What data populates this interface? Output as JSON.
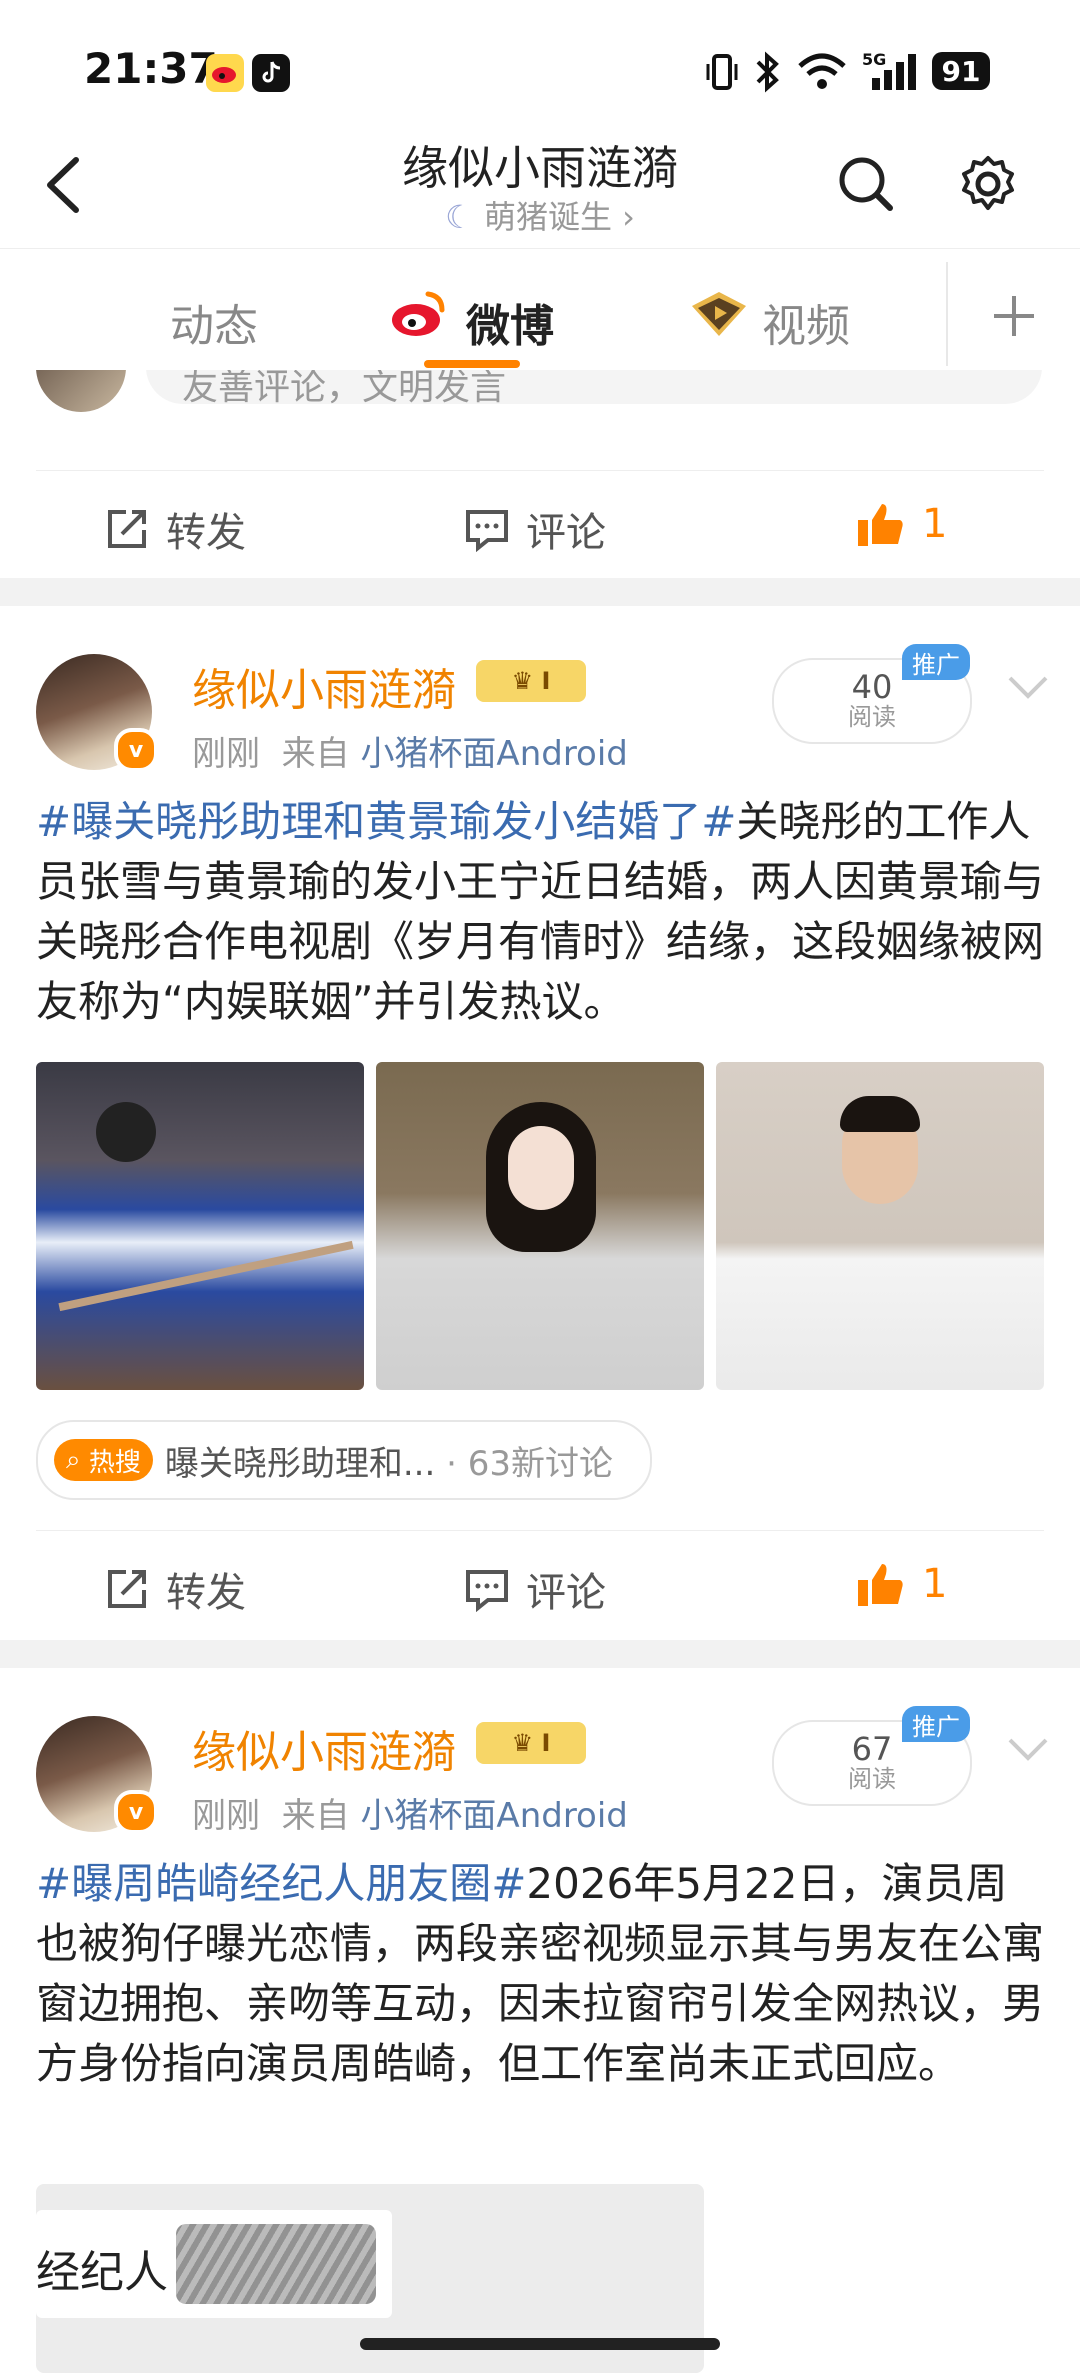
{
  "status_bar": {
    "time": "21:37",
    "battery": "91",
    "network": "5G"
  },
  "header": {
    "title": "缘似小雨涟漪",
    "subtitle": "萌猪诞生",
    "subtitle_chevron": "›"
  },
  "tabs": [
    {
      "label": "动态"
    },
    {
      "label": "微博"
    },
    {
      "label": "视频"
    }
  ],
  "prev_post": {
    "comment_placeholder": "友善评论，文明发言",
    "actions": {
      "repost": "转发",
      "comment": "评论",
      "like_count": "1"
    }
  },
  "post1": {
    "author": "缘似小雨涟漪",
    "rank_badge": "I",
    "time": "刚刚",
    "from_label": "来自",
    "source": "小猪杯面Android",
    "reads": "40",
    "reads_label": "阅读",
    "promo": "推广",
    "hashtag": "#曝关晓彤助理和黄景瑜发小结婚了#",
    "text": "关晓彤的工作人员张雪与黄景瑜的发小王宁近日结婚，两人因黄景瑜与关晓彤合作电视剧《岁月有情时》结缘，这段姻缘被网友称为“内娱联姻”并引发热议。",
    "hot_search": {
      "badge": "热搜",
      "text": "曝关晓彤助理和...",
      "count": "· 63新讨论"
    },
    "actions": {
      "repost": "转发",
      "comment": "评论",
      "like_count": "1"
    }
  },
  "post2": {
    "author": "缘似小雨涟漪",
    "rank_badge": "I",
    "time": "刚刚",
    "from_label": "来自",
    "source": "小猪杯面Android",
    "reads": "67",
    "reads_label": "阅读",
    "promo": "推广",
    "hashtag": "#曝周皓崎经纪人朋友圈#",
    "text": "2026年5月22日，演员周也被狗仔曝光恋情，两段亲密视频显示其与男友在公寓窗边拥抱、亲吻等互动，因未拉窗帘引发全网热议，男方身份指向演员周皓崎，但工作室尚未正式回应。",
    "image_caption": "经纪人"
  },
  "colors": {
    "accent": "#ff8200",
    "link": "#3a6bb0",
    "name": "#f08300",
    "promo": "#4a9ce8"
  }
}
